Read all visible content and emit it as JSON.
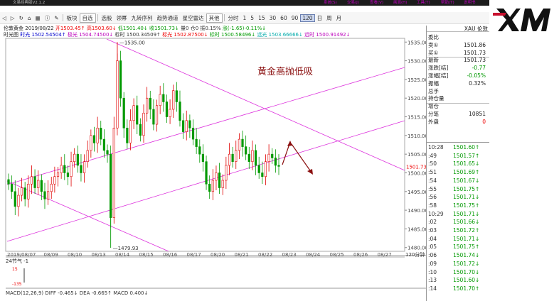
{
  "window": {
    "title": "文易经典版V2.1.2",
    "menu": [
      "系统(S)",
      "交易(J)",
      "查看(V)",
      "画面(H)",
      "工具(T)",
      "帮助(T)",
      "说明书"
    ]
  },
  "toolbar": {
    "self_select": "自选",
    "items_left": [
      "板块"
    ],
    "items_mid": [
      "选股",
      "领幂",
      "九转序列",
      "趋势通道",
      "星空雷达"
    ],
    "other_dd": "其他",
    "periods": [
      "分时",
      "1",
      "5",
      "15",
      "30",
      "60",
      "90"
    ],
    "active_period": "120",
    "periods_tail": [
      "日",
      "周",
      "月"
    ]
  },
  "ohlc": {
    "name": "伦敦黄金",
    "date": "2019/08/22",
    "open": "开1503.45↑",
    "high": "高1503.60↓",
    "low": "低1501.40↓",
    "close": "收1501.73↓",
    "vol": "量0",
    "oi": "仓0",
    "amp": "振0.15%",
    "chg": "涨(-1.65)-0.11%↓"
  },
  "ma": {
    "label": "时光图",
    "shi": "时光 1502.54504↑",
    "ji": "极光 1504.74500↓",
    "biao": "标时 1500.34509↑",
    "biaoguang": "标光 1502.87500↓",
    "biaoshi": "标时 1500.58496↓",
    "yuanguang": "远光 1503.66666↓",
    "yuanshi": "远时 1500.91492↓"
  },
  "chart_data": {
    "type": "candlestick",
    "annotation": "黄金高抛低吸",
    "y_ticks": [
      "1535.00",
      "1530.00",
      "1525.00",
      "1520.00",
      "1515.00",
      "1510.00",
      "1505.00",
      "1500.00",
      "1495.00",
      "1490.00",
      "1485.00",
      "1480.00"
    ],
    "ylim": [
      1479,
      1536
    ],
    "x_labels": [
      "2019/08/07",
      "08/09",
      "08/10",
      "08/13",
      "08/14",
      "08/15",
      "08/16",
      "08/17",
      "08/20",
      "08/21",
      "08/22",
      "08/23",
      "08/24",
      "08/25",
      "08/26",
      "08/27"
    ],
    "high_label": "1535.00",
    "low_label": "1479.93",
    "current_price": "1501.73",
    "sub_axis": "120分钟",
    "closes": [
      1497,
      1495,
      1491,
      1494,
      1496,
      1493,
      1497,
      1499,
      1496,
      1498,
      1495,
      1493,
      1495,
      1497,
      1499,
      1500,
      1502,
      1500,
      1499,
      1503,
      1505,
      1502,
      1500,
      1503,
      1506,
      1510,
      1508,
      1512,
      1509,
      1506,
      1505,
      1488,
      1512,
      1530,
      1520,
      1512,
      1508,
      1514,
      1518,
      1513,
      1510,
      1516,
      1520,
      1517,
      1513,
      1518,
      1521,
      1519,
      1515,
      1517,
      1522,
      1519,
      1514,
      1511,
      1514,
      1512,
      1509,
      1507,
      1505,
      1503,
      1497,
      1495,
      1498,
      1500,
      1496,
      1498,
      1502,
      1505,
      1503,
      1506,
      1509,
      1507,
      1505,
      1503,
      1506,
      1502,
      1500,
      1499,
      1503,
      1505,
      1504,
      1502,
      1501.73
    ]
  },
  "sub_indicator": {
    "name": "24节气",
    "value": "-1",
    "level_hi": "15",
    "level_lo": "-135"
  },
  "macd": "MACD(12,26,9)  DIFF -0.465↓  DEA -0.665↑  MACD 0.400↓",
  "panel": {
    "header": "XAU 伦敦",
    "rows": [
      {
        "l": "委比",
        "v": "",
        "x": ""
      },
      {
        "l": "卖①",
        "v": "1501.86",
        "x": ""
      },
      {
        "l": "买①",
        "v": "1501.73",
        "x": ""
      },
      {
        "l": "最新",
        "v": "1501.73",
        "x": ""
      },
      {
        "l": "涨跌[结]",
        "v": "-0.77",
        "x": ""
      },
      {
        "l": "涨幅[结]",
        "v": "-0.05%",
        "x": ""
      },
      {
        "l": "振幅",
        "v": "0.32%",
        "x": ""
      },
      {
        "l": "总手",
        "v": "",
        "x": ""
      },
      {
        "l": "持仓量",
        "v": "",
        "x": ""
      },
      {
        "l": "增仓",
        "v": "",
        "x": ""
      },
      {
        "l": "分笔",
        "v": "10851",
        "x": ""
      },
      {
        "l": "外盘",
        "v": "0",
        "x": ""
      }
    ],
    "ticks": [
      {
        "t": "10:28",
        "p": "1501.60↑"
      },
      {
        "t": ":49",
        "p": "1501.57↑"
      },
      {
        "t": ":50",
        "p": "1501.65↓"
      },
      {
        "t": ":51",
        "p": "1501.69↑"
      },
      {
        "t": ":54",
        "p": "1501.67↓"
      },
      {
        "t": ":55",
        "p": "1501.75↑"
      },
      {
        "t": ":56",
        "p": "1501.71↓"
      },
      {
        "t": ":58",
        "p": "1501.75↑"
      },
      {
        "t": "10:29",
        "p": "1501.71↓"
      },
      {
        "t": ":02",
        "p": "1501.66↓"
      },
      {
        "t": ":03",
        "p": "1501.72↑"
      },
      {
        "t": ":04",
        "p": "1501.71↓"
      },
      {
        "t": ":05",
        "p": "1501.75↑"
      },
      {
        "t": ":06",
        "p": "1501.74↓"
      },
      {
        "t": ":09",
        "p": "1501.72↓"
      },
      {
        "t": ":10",
        "p": "1501.70↓"
      },
      {
        "t": ":13",
        "p": "1501.60↓"
      },
      {
        "t": ":14",
        "p": "1501.70↑"
      }
    ]
  },
  "logo": "XM",
  "colors": {
    "up": "#e00000",
    "down": "#009900",
    "channel": "#dd33dd",
    "arrow": "#8b1010",
    "annotation": "#8b1010"
  }
}
